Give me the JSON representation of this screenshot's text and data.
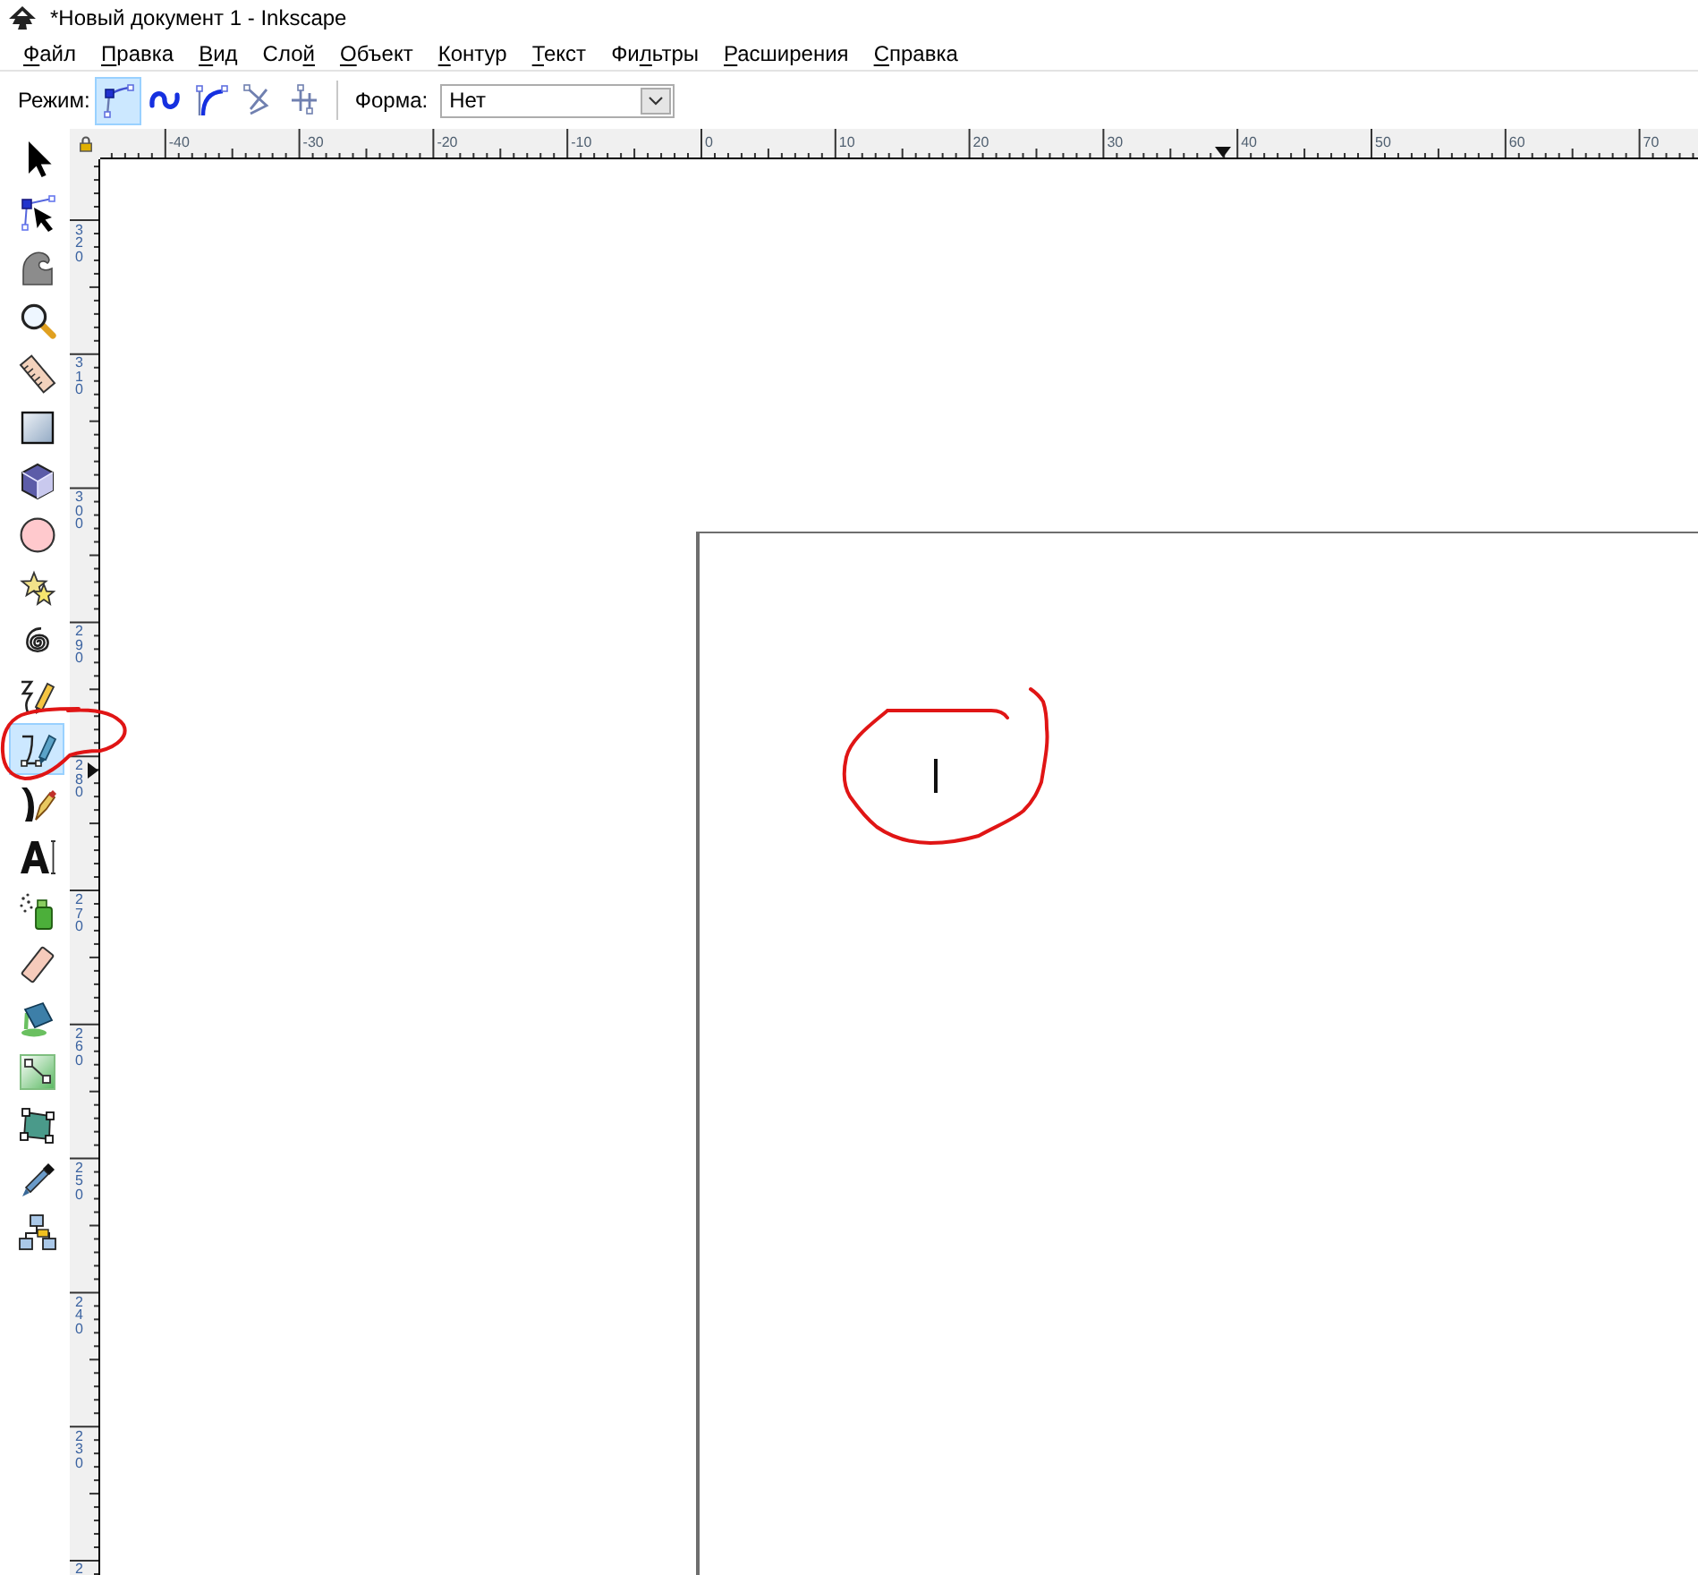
{
  "window": {
    "title": "*Новый документ 1 - Inkscape"
  },
  "menu": [
    {
      "parts": [
        {
          "text": "Ф",
          "underline": true
        },
        {
          "text": "айл",
          "underline": false
        }
      ]
    },
    {
      "parts": [
        {
          "text": "П",
          "underline": true
        },
        {
          "text": "равка",
          "underline": false
        }
      ]
    },
    {
      "parts": [
        {
          "text": "В",
          "underline": true
        },
        {
          "text": "ид",
          "underline": false
        }
      ]
    },
    {
      "parts": [
        {
          "text": "Сло",
          "underline": false
        },
        {
          "text": "й",
          "underline": true
        }
      ]
    },
    {
      "parts": [
        {
          "text": "О",
          "underline": true
        },
        {
          "text": "бъект",
          "underline": false
        }
      ]
    },
    {
      "parts": [
        {
          "text": "К",
          "underline": true
        },
        {
          "text": "онтур",
          "underline": false
        }
      ]
    },
    {
      "parts": [
        {
          "text": "Т",
          "underline": true
        },
        {
          "text": "екст",
          "underline": false
        }
      ]
    },
    {
      "parts": [
        {
          "text": "Фи",
          "underline": false
        },
        {
          "text": "л",
          "underline": true
        },
        {
          "text": "ьтры",
          "underline": false
        }
      ]
    },
    {
      "parts": [
        {
          "text": "Р",
          "underline": true
        },
        {
          "text": "асширения",
          "underline": false
        }
      ]
    },
    {
      "parts": [
        {
          "text": "С",
          "underline": true
        },
        {
          "text": "правка",
          "underline": false
        }
      ]
    }
  ],
  "tool_controls": {
    "mode_label": "Режим:",
    "modes": [
      {
        "kind": "bezier",
        "selected": true
      },
      {
        "kind": "spiro",
        "selected": false
      },
      {
        "kind": "bspline",
        "selected": false
      },
      {
        "kind": "zigzag",
        "selected": false
      },
      {
        "kind": "paraxial",
        "selected": false
      }
    ],
    "shape_label": "Форма:",
    "shape": {
      "value": "Нет"
    }
  },
  "toolbox": [
    {
      "kind": "selector",
      "selected": false
    },
    {
      "kind": "node",
      "selected": false
    },
    {
      "kind": "tweak",
      "selected": false
    },
    {
      "kind": "zoom",
      "selected": false
    },
    {
      "kind": "measure",
      "selected": false
    },
    {
      "kind": "rect",
      "selected": false
    },
    {
      "kind": "box3d",
      "selected": false
    },
    {
      "kind": "ellipse",
      "selected": false
    },
    {
      "kind": "star",
      "selected": false
    },
    {
      "kind": "spiral",
      "selected": false
    },
    {
      "kind": "pencil",
      "selected": false
    },
    {
      "kind": "pen",
      "selected": true
    },
    {
      "kind": "calligraphy",
      "selected": false
    },
    {
      "kind": "text",
      "selected": false
    },
    {
      "kind": "spray",
      "selected": false
    },
    {
      "kind": "eraser",
      "selected": false
    },
    {
      "kind": "bucket",
      "selected": false
    },
    {
      "kind": "gradient",
      "selected": false
    },
    {
      "kind": "mesh",
      "selected": false
    },
    {
      "kind": "dropper",
      "selected": false
    },
    {
      "kind": "connector",
      "selected": false
    }
  ],
  "rulers": {
    "horizontal": {
      "labels": [
        "-40",
        "-30",
        "-20",
        "-10",
        "0",
        "10",
        "20",
        "30",
        "40",
        "50",
        "60",
        "70"
      ]
    },
    "vertical": {
      "labels": [
        "320",
        "310",
        "300",
        "290",
        "280",
        "270",
        "260",
        "250",
        "240",
        "230",
        "2"
      ]
    }
  }
}
